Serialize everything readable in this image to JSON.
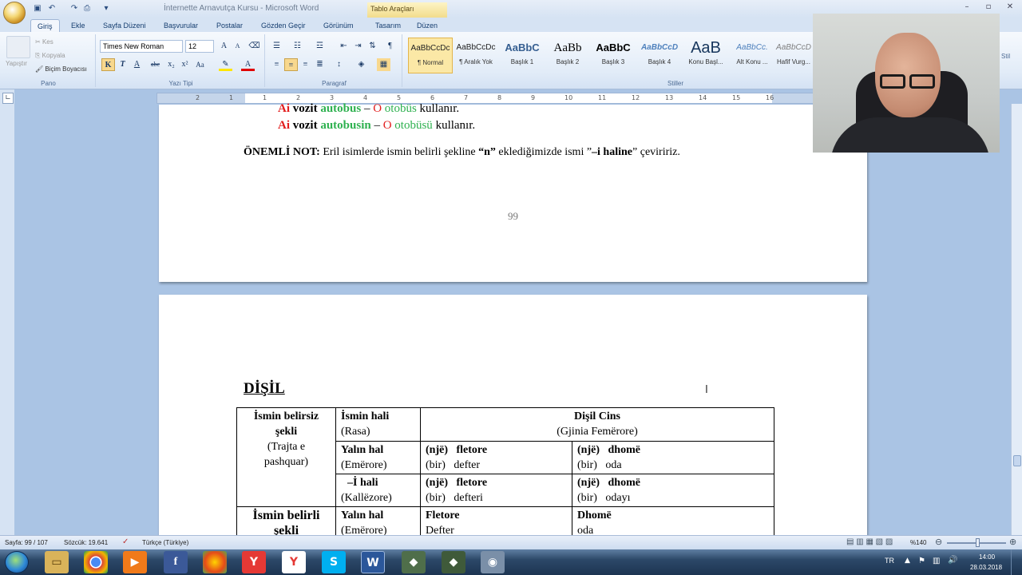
{
  "titlebar": {
    "title": "İnternette Arnavutça Kursu - Microsoft Word",
    "contextual": "Tablo Araçları"
  },
  "tabs": [
    "Giriş",
    "Ekle",
    "Sayfa Düzeni",
    "Başvurular",
    "Postalar",
    "Gözden Geçir",
    "Görünüm",
    "Tasarım",
    "Düzen"
  ],
  "clipboard": {
    "paste": "Yapıştır",
    "cut": "Kes",
    "copy": "Kopyala",
    "format_painter": "Biçim Boyacısı",
    "group": "Pano"
  },
  "font": {
    "name": "Times New Roman",
    "size": "12",
    "group": "Yazı Tipi",
    "bold": "K",
    "italic": "T",
    "underline": "A"
  },
  "paragraph": {
    "group": "Paragraf"
  },
  "styles": {
    "group": "Stiller",
    "items": [
      {
        "preview": "AaBbCcDc",
        "name": "¶ Normal"
      },
      {
        "preview": "AaBbCcDc",
        "name": "¶ Aralık Yok"
      },
      {
        "preview": "AaBbC",
        "name": "Başlık 1"
      },
      {
        "preview": "AaBb",
        "name": "Başlık 2"
      },
      {
        "preview": "AaBbC",
        "name": "Başlık 3"
      },
      {
        "preview": "AaBbCcD",
        "name": "Başlık 4"
      },
      {
        "preview": "AaB",
        "name": "Konu Başl..."
      },
      {
        "preview": "AaBbCc.",
        "name": "Alt Konu ..."
      },
      {
        "preview": "AaBbCcD",
        "name": "Hafif Vurg..."
      }
    ],
    "change": "Stil"
  },
  "page1": {
    "line1": {
      "pron": "Ai",
      "verb": "vozit",
      "noun": "autobus",
      "dash": "–",
      "pron_tr": "O",
      "noun_tr": "otobüs",
      "verb_tr": "kullanır."
    },
    "line2": {
      "pron": "Ai",
      "verb": "vozit",
      "noun": "autobusin",
      "dash": "–",
      "pron_tr": "O",
      "noun_tr": "otobüsü",
      "verb_tr": "kullanır."
    },
    "note_label": "ÖNEMLİ NOT:",
    "note_text": "Eril isimlerde ismin belirli şekline",
    "note_q1": "“n”",
    "note_text2": "eklediğimizde ismi ”",
    "note_q2": "–i haline",
    "note_text3": "” çeviririz.",
    "page_number": "99"
  },
  "page2": {
    "heading": "DİŞİL",
    "table": {
      "h1a": "İsmin belirsiz",
      "h1b": "şekli",
      "h1c": "(Trajta e",
      "h1d": "pashquar)",
      "h2a": "İsmin hali",
      "h2b": "(Rasa)",
      "h3a": "Dişil Cins",
      "h3b": "(Gjinia Femërore)",
      "r1a": "Yalın hal",
      "r1b": "(Emërore)",
      "r1c1": "(një)",
      "r1c2": "fletore",
      "r1c3": "(bir)",
      "r1c4": "defter",
      "r1d1": "(një)",
      "r1d2": "dhomë",
      "r1d3": "(bir)",
      "r1d4": "oda",
      "r2a": "–İ hali",
      "r2b": "(Kallëzore)",
      "r2c1": "(një)",
      "r2c2": "fletore",
      "r2c3": "(bir)",
      "r2c4": "defteri",
      "r2d1": "(një)",
      "r2d2": "dhomë",
      "r2d3": "(bir)",
      "r2d4": "odayı",
      "r3h1": "İsmin belirli",
      "r3h2": "şekli",
      "r3a": "Yalın hal",
      "r3b": "(Emërore)",
      "r3c1": "Fletore",
      "r3c2": "Defter",
      "r3d1": "Dhomë",
      "r3d2": "oda"
    }
  },
  "status": {
    "page": "Sayfa: 99 / 107",
    "words": "Sözcük: 19.641",
    "lang": "Türkçe (Türkiye)",
    "zoom": "%140"
  },
  "taskbar": {
    "lang": "TR",
    "time": "14:00",
    "date": "28.03.2018"
  },
  "ruler_numbers": [
    "2",
    "1",
    "1",
    "2",
    "3",
    "4",
    "5",
    "6",
    "7",
    "8",
    "9",
    "10",
    "11",
    "12",
    "13",
    "14",
    "15",
    "16"
  ]
}
